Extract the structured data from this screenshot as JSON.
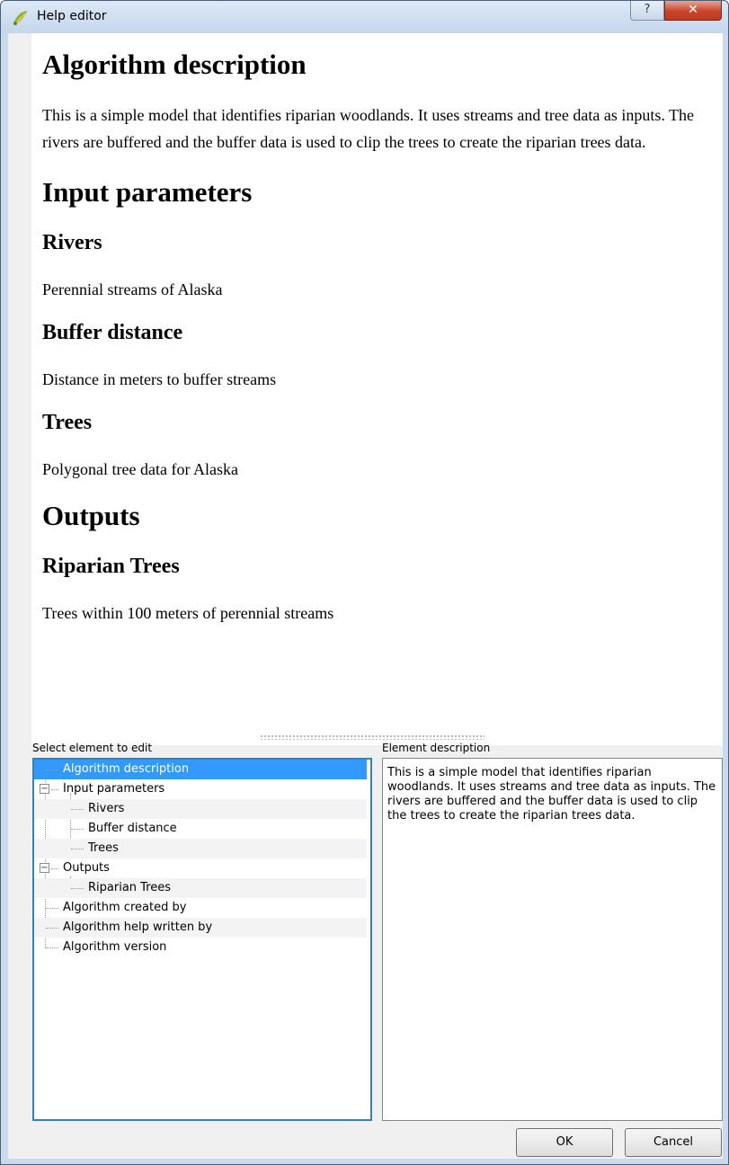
{
  "window": {
    "title": "Help editor",
    "help_button": "?",
    "close_button": "✕"
  },
  "preview": {
    "algorithm_heading": "Algorithm description",
    "algorithm_text": "This is a simple model that identifies riparian woodlands. It uses streams and tree data as inputs. The rivers are buffered and the buffer data is used to clip the trees to create the riparian trees data.",
    "inputs_heading": "Input parameters",
    "params": [
      {
        "name": "Rivers",
        "description": "Perennial streams of Alaska"
      },
      {
        "name": "Buffer distance",
        "description": "Distance in meters to buffer streams"
      },
      {
        "name": "Trees",
        "description": "Polygonal tree data for Alaska"
      }
    ],
    "outputs_heading": "Outputs",
    "outputs": [
      {
        "name": "Riparian Trees",
        "description": "Trees within 100 meters of perennial streams"
      }
    ]
  },
  "tree": {
    "label": "Select element to edit",
    "items": [
      "Algorithm description",
      "Input parameters",
      "Rivers",
      "Buffer distance",
      "Trees",
      "Outputs",
      "Riparian Trees",
      "Algorithm created by",
      "Algorithm help written by",
      "Algorithm version"
    ],
    "selected_index": 0
  },
  "description": {
    "label": "Element description",
    "text": "This is a simple model that identifies riparian woodlands. It uses streams and tree data as inputs. The rivers are buffered and the buffer data is used to clip the trees to create the riparian trees data."
  },
  "buttons": {
    "ok": "OK",
    "cancel": "Cancel"
  },
  "colors": {
    "selection": "#3399ff",
    "close_button": "#c9462c"
  }
}
